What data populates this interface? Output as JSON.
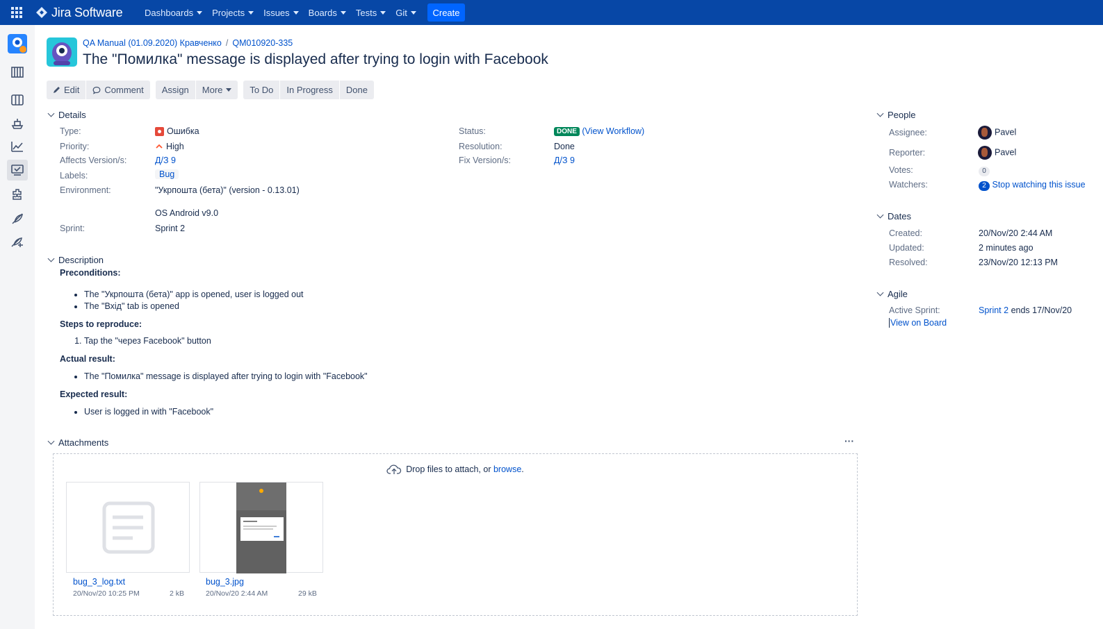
{
  "topbar": {
    "logo": "Jira Software",
    "nav": [
      "Dashboards",
      "Projects",
      "Issues",
      "Boards",
      "Tests",
      "Git"
    ],
    "create": "Create",
    "colors": {
      "bar": "#0747a6",
      "create": "#0065ff"
    }
  },
  "sidebar": {
    "icons": [
      "project-avatar-icon",
      "backlog-icon",
      "board-icon",
      "releases-icon",
      "reports-icon",
      "issues-icon",
      "components-icon",
      "feather-icon",
      "tests-icon"
    ]
  },
  "breadcrumb": {
    "project": "QA Manual (01.09.2020) Кравченко",
    "separator": "/",
    "issue_key": "QM010920-335"
  },
  "issue": {
    "title": "The \"Помилка\" message is displayed after trying to login with Facebook"
  },
  "ops": {
    "edit": "Edit",
    "comment": "Comment",
    "assign": "Assign",
    "more": "More",
    "todo": "To Do",
    "inprogress": "In Progress",
    "done": "Done"
  },
  "details": {
    "heading": "Details",
    "type_label": "Type:",
    "type": "Ошибка",
    "priority_label": "Priority:",
    "priority": "High",
    "affects_label": "Affects Version/s:",
    "affects": "Д/З 9",
    "labels_label": "Labels:",
    "labels": "Bug",
    "env_label": "Environment:",
    "env_line1": "\"Укрпошта (бета)\" (version - 0.13.01)",
    "env_line2": "OS Android v9.0",
    "sprint_label": "Sprint:",
    "sprint": "Sprint 2",
    "status_label": "Status:",
    "status": "DONE",
    "view_workflow": "(View Workflow)",
    "resolution_label": "Resolution:",
    "resolution": "Done",
    "fix_label": "Fix Version/s:",
    "fix": "Д/З 9"
  },
  "description": {
    "heading": "Description",
    "pre_h": "Preconditions:",
    "pre": [
      "The \"Укрпошта (бета)\" app is opened, user is logged out",
      "The \"Вхід\" tab is opened"
    ],
    "steps_h": "Steps to reproduce:",
    "steps": [
      "Tap the \"через Facebook\" button"
    ],
    "actual_h": "Actual result:",
    "actual": [
      "The \"Помилка\" message is displayed after trying to login with \"Facebook\""
    ],
    "expected_h": "Expected result:",
    "expected": [
      "User is logged in with \"Facebook\""
    ]
  },
  "attachments": {
    "heading": "Attachments",
    "menu": "···",
    "drop_text": "Drop files to attach, or ",
    "browse": "browse",
    "drop_end": ".",
    "files": [
      {
        "name": "bug_3_log.txt",
        "date": "20/Nov/20 10:25 PM",
        "size": "2 kB"
      },
      {
        "name": "bug_3.jpg",
        "date": "20/Nov/20 2:44 AM",
        "size": "29 kB"
      }
    ]
  },
  "people": {
    "heading": "People",
    "assignee_label": "Assignee:",
    "assignee": "Pavel",
    "reporter_label": "Reporter:",
    "reporter": "Pavel",
    "votes_label": "Votes:",
    "votes": "0",
    "watchers_label": "Watchers:",
    "watchers": "2",
    "stop_watching": "Stop watching this issue"
  },
  "dates": {
    "heading": "Dates",
    "created_label": "Created:",
    "created": "20/Nov/20 2:44 AM",
    "updated_label": "Updated:",
    "updated": "2 minutes ago",
    "resolved_label": "Resolved:",
    "resolved": "23/Nov/20 12:13 PM"
  },
  "agile": {
    "heading": "Agile",
    "active_label": "Active Sprint:",
    "active_sprint": "Sprint 2",
    "ends": " ends 17/Nov/20",
    "view_board": "View on Board"
  }
}
